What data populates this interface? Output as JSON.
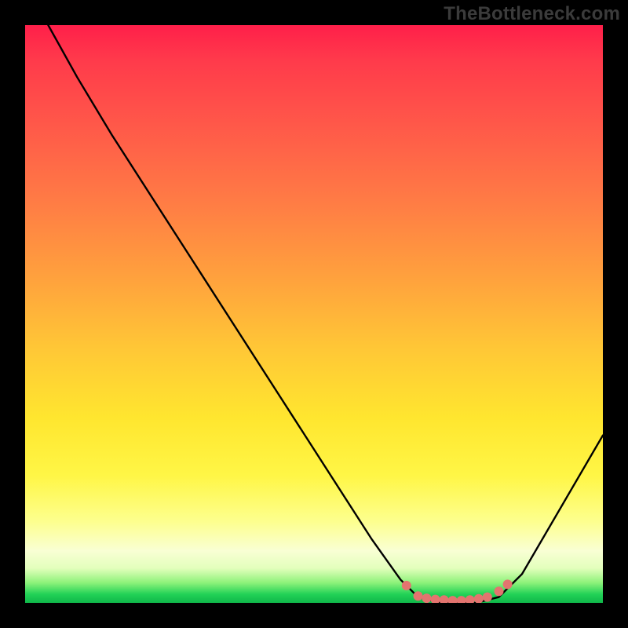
{
  "watermark": "TheBottleneck.com",
  "chart_data": {
    "type": "line",
    "title": "",
    "xlabel": "",
    "ylabel": "",
    "xlim": [
      0,
      100
    ],
    "ylim": [
      0,
      100
    ],
    "description": "Bottleneck curve: steep descent from top-left, reaching a flat minimum near zero around x≈68–82, then rising toward the right edge. Pink markers highlight the near-zero flat region.",
    "series": [
      {
        "name": "bottleneck-curve",
        "color": "#000000",
        "points": [
          {
            "x": 4,
            "y": 100
          },
          {
            "x": 9,
            "y": 91
          },
          {
            "x": 15,
            "y": 81
          },
          {
            "x": 60,
            "y": 11
          },
          {
            "x": 65,
            "y": 4
          },
          {
            "x": 68,
            "y": 1
          },
          {
            "x": 72,
            "y": 0
          },
          {
            "x": 78,
            "y": 0
          },
          {
            "x": 82,
            "y": 1
          },
          {
            "x": 86,
            "y": 5
          },
          {
            "x": 100,
            "y": 29
          }
        ]
      },
      {
        "name": "optimal-band-markers",
        "color": "#e3746f",
        "points": [
          {
            "x": 66,
            "y": 3
          },
          {
            "x": 68,
            "y": 1.2
          },
          {
            "x": 69.5,
            "y": 0.8
          },
          {
            "x": 71,
            "y": 0.6
          },
          {
            "x": 72.5,
            "y": 0.5
          },
          {
            "x": 74,
            "y": 0.4
          },
          {
            "x": 75.5,
            "y": 0.4
          },
          {
            "x": 77,
            "y": 0.5
          },
          {
            "x": 78.5,
            "y": 0.7
          },
          {
            "x": 80,
            "y": 1.0
          },
          {
            "x": 82,
            "y": 2.0
          },
          {
            "x": 83.5,
            "y": 3.2
          }
        ]
      }
    ]
  }
}
